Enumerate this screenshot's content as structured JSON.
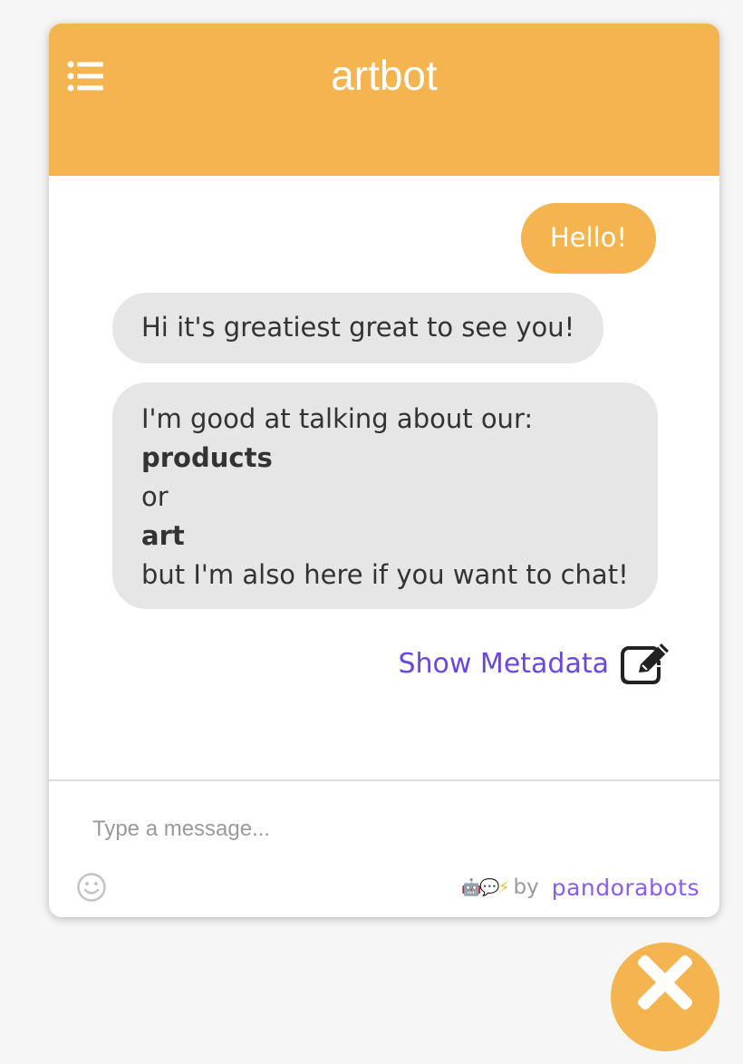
{
  "header": {
    "title": "artbot",
    "menu_icon": "list-icon",
    "bg_color": "#f4b450"
  },
  "messages": {
    "user_message": "Hello!",
    "bot_message_1": "Hi it's greatiest great to see you!",
    "bot_message_2": {
      "line1": "I'm good at talking about our:",
      "line2": "products",
      "line3": "or",
      "line4": "art",
      "line5": "but I'm also here if you want to chat!"
    },
    "show_metadata": "Show Metadata",
    "metadata_icon": "edit-icon"
  },
  "composer": {
    "placeholder": "Type a message...",
    "emoji_icon": "smiley-icon"
  },
  "footer": {
    "emojis": "🤖💬⚡",
    "by": "by",
    "brand": "pandorabots"
  },
  "close_button": {
    "icon": "close-icon"
  },
  "colors": {
    "accent": "#f4b450",
    "link": "#6b46e0",
    "brand": "#8a5cf0",
    "bot_bubble": "#e6e6e6"
  }
}
